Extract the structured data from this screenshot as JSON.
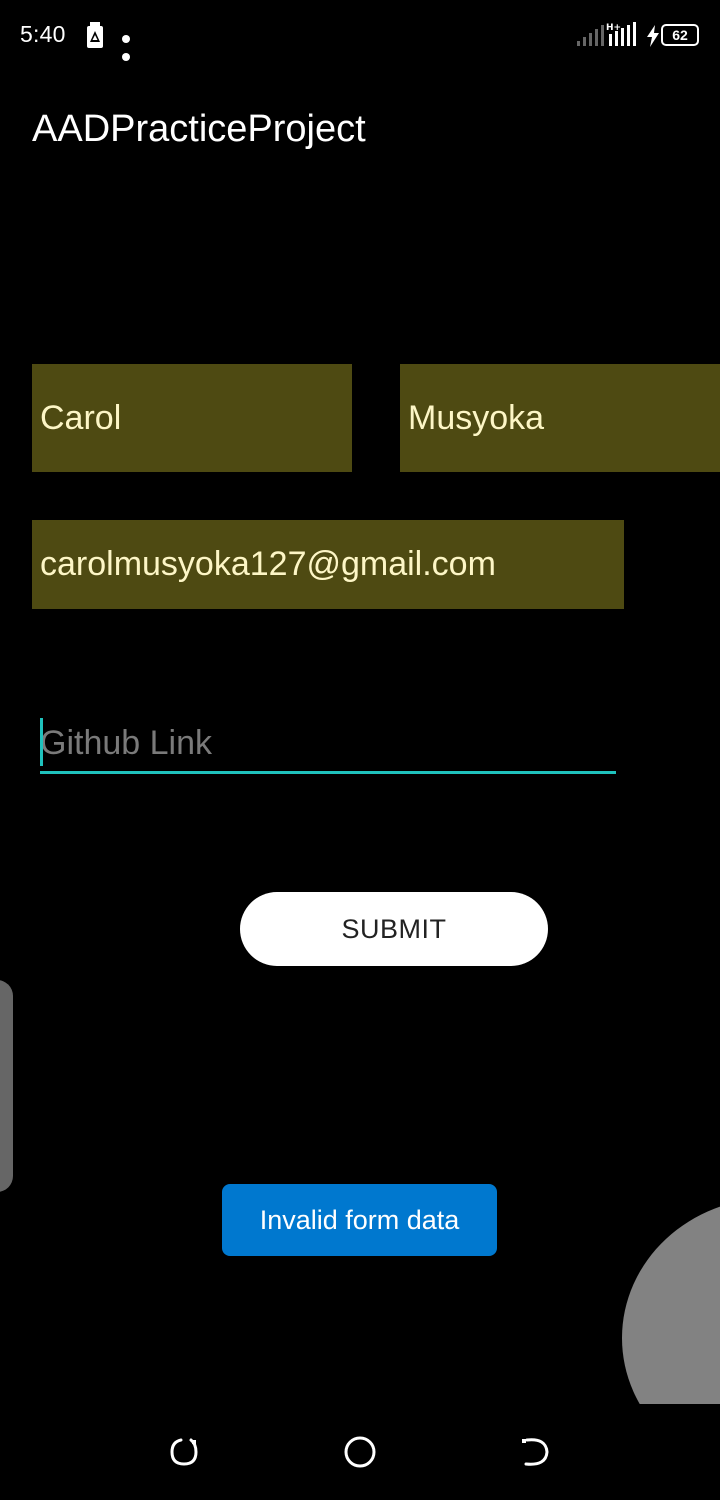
{
  "status_bar": {
    "time": "5:40",
    "battery_level": "62",
    "icons": [
      "notification-app-icon",
      "more-dots-icon",
      "signal-icon",
      "signal-data-icon",
      "charging-icon",
      "battery-icon"
    ]
  },
  "app": {
    "title": "AADPracticeProject"
  },
  "form": {
    "first_name": "Carol",
    "last_name": "Musyoka",
    "email": "carolmusyoka127@gmail.com",
    "github_placeholder": "Github Link",
    "github_value": "",
    "submit_label": "SUBMIT"
  },
  "toast": {
    "message": "Invalid form data"
  },
  "colors": {
    "background": "#000000",
    "field_background": "#4e4a12",
    "field_text": "#fdf6c6",
    "accent": "#1fc2bd",
    "toast_background": "#0078cf",
    "button_background": "#ffffff"
  },
  "nav_bar": {
    "icons": [
      "recent-apps-icon",
      "home-icon",
      "back-icon"
    ]
  }
}
